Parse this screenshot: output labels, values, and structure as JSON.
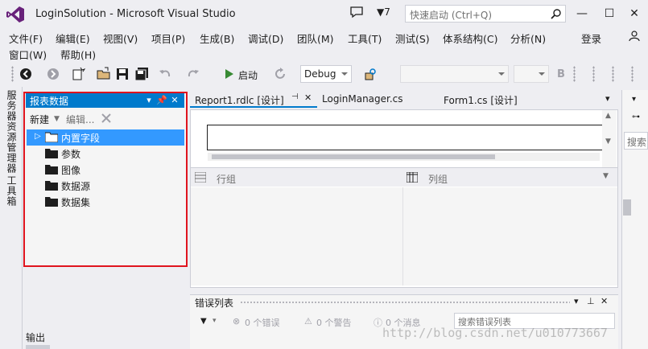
{
  "app": {
    "window_title": "LoginSolution - Microsoft Visual Studio",
    "notification_count": "▼7",
    "quick_launch_placeholder": "快速启动 (Ctrl+Q)",
    "login_label": "登录"
  },
  "menu": [
    "文件(F)",
    "编辑(E)",
    "视图(V)",
    "项目(P)",
    "生成(B)",
    "调试(D)",
    "团队(M)",
    "工具(T)",
    "测试(S)",
    "体系结构(C)",
    "分析(N)",
    "窗口(W)",
    "帮助(H)"
  ],
  "toolbar": {
    "start_label": "启动",
    "config_value": "Debug",
    "bold_label": "B"
  },
  "left_strip": {
    "tab1": "服务器资源管理器",
    "tab2": "工具箱"
  },
  "report_data_panel": {
    "title": "报表数据",
    "new_label": "新建",
    "edit_label": "编辑...",
    "items": [
      "内置字段",
      "参数",
      "图像",
      "数据源",
      "数据集"
    ],
    "selected_index": 0
  },
  "doc_tabs": [
    {
      "label": "Report1.rdlc [设计]",
      "active": true
    },
    {
      "label": "LoginManager.cs",
      "active": false
    },
    {
      "label": "Form1.cs [设计]",
      "active": false
    }
  ],
  "designer": {
    "row_groups_label": "行组",
    "column_groups_label": "列组"
  },
  "error_list": {
    "title": "错误列表",
    "errors": "0 个错误",
    "warnings": "0 个警告",
    "messages": "0 个消息",
    "search_placeholder": "搜索错误列表"
  },
  "right_panel": {
    "search_label": "搜索"
  },
  "bottom": {
    "output_tab": "输出",
    "watermark": "http://blog.csdn.net/u010773667"
  },
  "colors": {
    "accent": "#007acc",
    "selection": "#3399ff",
    "highlight_frame": "#e0141e",
    "vs_purple": "#68217a"
  }
}
